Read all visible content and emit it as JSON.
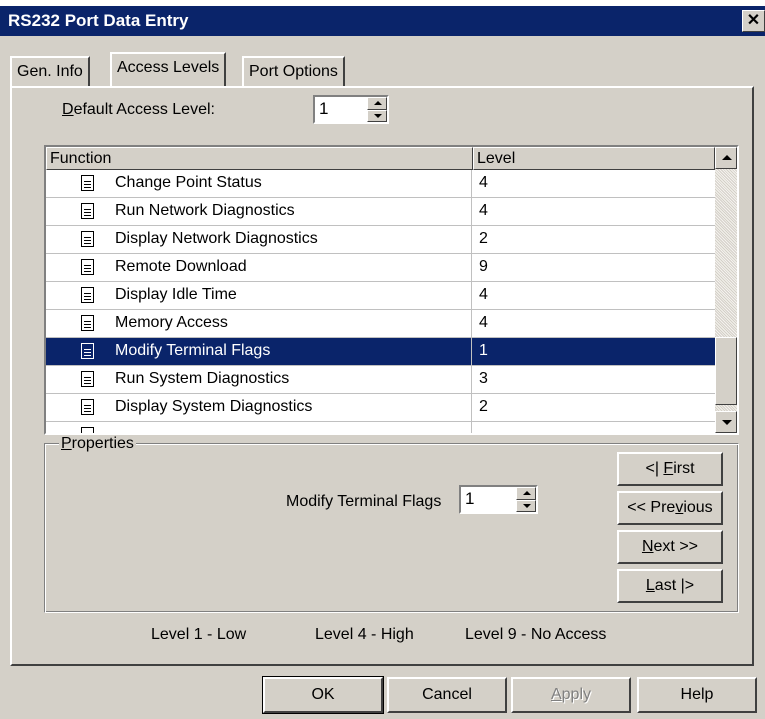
{
  "window": {
    "title": "RS232 Port Data Entry",
    "close_glyph": "✕"
  },
  "tabs": [
    {
      "label": "Gen. Info"
    },
    {
      "label": "Access Levels"
    },
    {
      "label": "Port Options"
    }
  ],
  "default_access": {
    "label_prefix": "D",
    "label_rest": "efault Access Level:",
    "value": "1"
  },
  "list": {
    "columns": [
      "Function",
      "Level"
    ],
    "rows": [
      {
        "function": "Change Point Status",
        "level": "4"
      },
      {
        "function": "Run Network Diagnostics",
        "level": "4"
      },
      {
        "function": "Display Network Diagnostics",
        "level": "2"
      },
      {
        "function": "Remote Download",
        "level": "9"
      },
      {
        "function": "Display Idle Time",
        "level": "4"
      },
      {
        "function": "Memory Access",
        "level": "4"
      },
      {
        "function": "Modify Terminal Flags",
        "level": "1"
      },
      {
        "function": "Run System Diagnostics",
        "level": "3"
      },
      {
        "function": "Display System Diagnostics",
        "level": "2"
      }
    ],
    "selected_row": 6
  },
  "properties": {
    "title_prefix": "P",
    "title_rest": "roperties",
    "field_label": "Modify Terminal Flags",
    "field_value": "1"
  },
  "nav_buttons": {
    "first": {
      "pre": "<| ",
      "ul": "F",
      "post": "irst"
    },
    "previous": {
      "pre": "<< Pre",
      "ul": "v",
      "post": "ious"
    },
    "next": {
      "pre": "",
      "ul": "N",
      "post": "ext >>"
    },
    "last": {
      "pre": "",
      "ul": "L",
      "post": "ast |>"
    }
  },
  "legend": {
    "low": "Level 1 - Low",
    "high": "Level 4 - High",
    "none": "Level 9 - No Access"
  },
  "dialog_buttons": {
    "ok": "OK",
    "cancel": "Cancel",
    "apply_ul": "A",
    "apply_rest": "pply",
    "help": "Help"
  },
  "colors": {
    "title_bar": "#0a246a",
    "selection": "#0a246a",
    "face": "#d4d0c8"
  }
}
